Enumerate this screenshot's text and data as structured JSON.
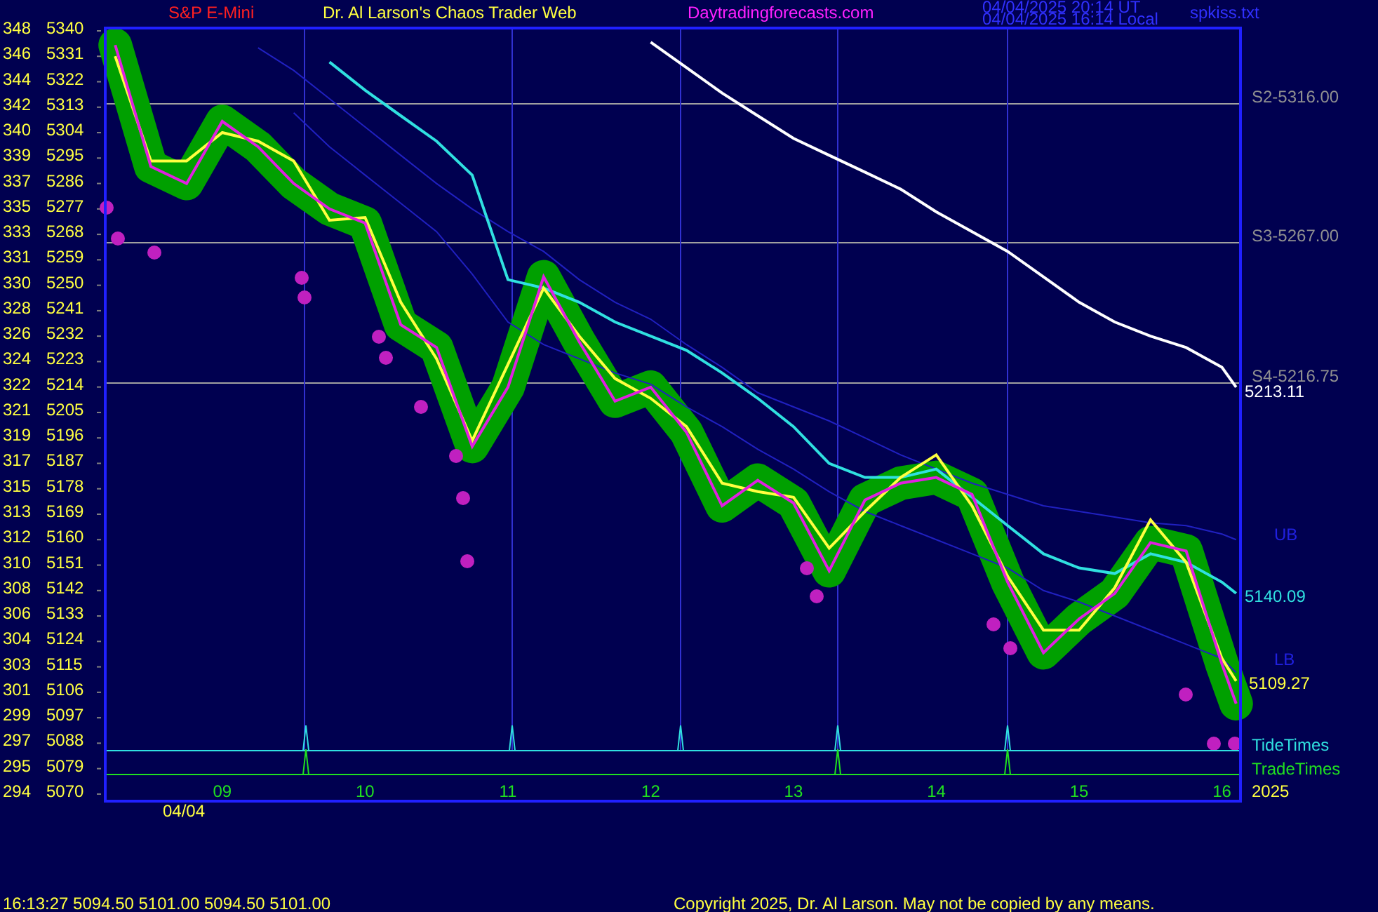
{
  "header": {
    "symbol": "S&P E-Mini",
    "title": "Dr. Al Larson's Chaos Trader Web",
    "site": "Daytradingforecasts.com",
    "timestamps": [
      "04/04/2025 20:14 UT",
      "04/04/2025 16:14 Local"
    ],
    "file": "spkiss.txt"
  },
  "cycle_axis": [
    "348",
    "346",
    "344",
    "342",
    "340",
    "339",
    "337",
    "335",
    "333",
    "331",
    "330",
    "328",
    "326",
    "324",
    "322",
    "321",
    "319",
    "317",
    "315",
    "313",
    "312",
    "310",
    "308",
    "306",
    "304",
    "303",
    "301",
    "299",
    "297",
    "295",
    "294"
  ],
  "chart_data": {
    "type": "line",
    "ylim": [
      5066.5,
      5340
    ],
    "xlim": [
      8.19,
      16.13
    ],
    "yticks": [
      5340,
      5331,
      5322,
      5313,
      5304,
      5295,
      5286,
      5277,
      5268,
      5259,
      5250,
      5241,
      5232,
      5223,
      5214,
      5205,
      5196,
      5187,
      5178,
      5169,
      5160,
      5151,
      5142,
      5133,
      5124,
      5115,
      5106,
      5097,
      5088,
      5079,
      5070
    ],
    "xticks": [
      {
        "value": 9,
        "label": "09"
      },
      {
        "value": 10,
        "label": "10"
      },
      {
        "value": 11,
        "label": "11"
      },
      {
        "value": 12,
        "label": "12"
      },
      {
        "value": 13,
        "label": "13"
      },
      {
        "value": 14,
        "label": "14"
      },
      {
        "value": 15,
        "label": "15"
      },
      {
        "value": 16,
        "label": "16"
      }
    ],
    "x": [
      8.25,
      8.5,
      8.75,
      9,
      9.25,
      9.5,
      9.75,
      10,
      10.25,
      10.5,
      10.75,
      11,
      11.25,
      11.5,
      11.75,
      12,
      12.25,
      12.5,
      12.75,
      13,
      13.25,
      13.5,
      13.75,
      14,
      14.25,
      14.5,
      14.75,
      15,
      15.25,
      15.5,
      15.75,
      16,
      16.1
    ],
    "series": [
      {
        "color": "#2020c0",
        "values": [
          null,
          null,
          null,
          null,
          5333,
          5325,
          5315,
          5305,
          5295,
          5285,
          5276,
          5268,
          5261,
          5251,
          5243,
          5237,
          5228,
          5220,
          5211,
          5206,
          5201,
          5195,
          5189,
          5184,
          5179,
          5175,
          5171,
          5169,
          5167,
          5165,
          5164,
          5161,
          5159
        ]
      },
      {
        "color": "#2020c0",
        "values": [
          null,
          null,
          null,
          null,
          null,
          5310,
          5298,
          5288,
          5278,
          5268,
          5253,
          5236,
          5228,
          5223,
          5218,
          5214,
          5206,
          5199,
          5191,
          5184,
          5176,
          5169,
          5164,
          5159,
          5154,
          5149,
          5141,
          5137,
          5132,
          5127,
          5122,
          5117,
          5112
        ]
      },
      {
        "color": "#ffffff",
        "values": [
          null,
          null,
          null,
          null,
          null,
          null,
          null,
          null,
          null,
          null,
          null,
          null,
          null,
          null,
          null,
          5335,
          5326,
          5317,
          5309,
          5301,
          5295,
          5289,
          5283,
          5275,
          5268,
          5261,
          5252,
          5243,
          5236,
          5231,
          5227,
          5220,
          5213
        ]
      },
      {
        "color": "#30e0e0",
        "values": [
          null,
          null,
          null,
          null,
          null,
          null,
          5328,
          5318,
          5309,
          5300,
          5288,
          5251,
          5248,
          5243,
          5236,
          5231,
          5226,
          5218,
          5209,
          5199,
          5186,
          5181,
          5181,
          5184,
          5174,
          5164,
          5154,
          5149,
          5147,
          5154,
          5151,
          5144,
          5140
        ]
      },
      {
        "color": "#ffff40",
        "values": [
          5330,
          5293,
          5293,
          5303,
          5300,
          5293,
          5272,
          5273,
          5243,
          5223,
          5194,
          5221,
          5248,
          5231,
          5216,
          5209,
          5199,
          5179,
          5176,
          5174,
          5156,
          5169,
          5181,
          5189,
          5171,
          5146,
          5127,
          5127,
          5142,
          5166,
          5151,
          5117,
          5109
        ]
      },
      {
        "color": "#e020e0",
        "values": [
          5334,
          5291,
          5285,
          5307,
          5298,
          5285,
          5276,
          5271,
          5235,
          5227,
          5192,
          5213,
          5252,
          5229,
          5208,
          5213,
          5197,
          5171,
          5180,
          5172,
          5148,
          5173,
          5179,
          5181,
          5175,
          5144,
          5119,
          5131,
          5140,
          5158,
          5155,
          5115,
          5101
        ]
      }
    ]
  },
  "x_axis": {
    "date": "04/04",
    "year": "2025"
  },
  "levels": [
    {
      "label": "S2-5316.00"
    },
    {
      "label": "S3-5267.00"
    },
    {
      "label": "S4-5216.75"
    }
  ],
  "line_labels": [
    {
      "kind": "white",
      "text": "5213.11"
    },
    {
      "kind": "band",
      "text": "UB"
    },
    {
      "kind": "cyan",
      "text": "5140.09"
    },
    {
      "kind": "band",
      "text": "LB"
    },
    {
      "kind": "yellow",
      "text": "5109.27"
    }
  ],
  "timing_lines": [
    {
      "kind": "tide",
      "label": "TideTimes"
    },
    {
      "kind": "trade",
      "label": "TradeTimes"
    }
  ],
  "footer": {
    "quote": "16:13:27  5094.50 5101.00 5094.50 5101.00",
    "copyright": "Copyright 2025, Dr. Al Larson. May not be copied by any means."
  }
}
